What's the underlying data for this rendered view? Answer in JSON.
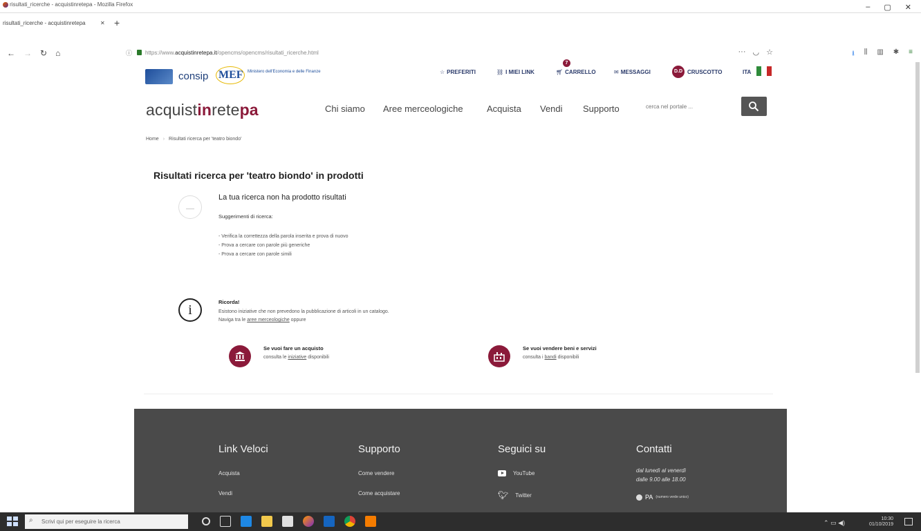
{
  "window": {
    "title": "risultati_ricerche - acquistinretepa - Mozilla Firefox",
    "controls": [
      "–",
      "▢",
      "✕"
    ]
  },
  "tab": {
    "label": "risultati_ricerche - acquistinretepa",
    "close": "✕",
    "new_tab": "+"
  },
  "urlbar": {
    "url_prefix": "https://www.",
    "url_domain": "acquistinretepa.it",
    "url_path": "/opencms/opencms/risultati_ricerche.html"
  },
  "header": {
    "consip": "consip",
    "mef": "MEF",
    "mef_sub": "Ministero dell'Economia e delle Finanze",
    "utility": {
      "preferiti": "PREFERITI",
      "miei_link": "I MIEI LINK",
      "carrello": "CARRELLO",
      "cart_count": "7",
      "messaggi": "MESSAGGI",
      "avatar": "D.D",
      "cruscotto": "CRUSCOTTO",
      "lang": "ITA"
    },
    "brand": {
      "part1": "acquist",
      "part2": "in",
      "part3": "rete",
      "part4": "pa"
    },
    "nav": [
      "Chi siamo",
      "Aree merceologiche",
      "Acquista",
      "Vendi",
      "Supporto"
    ],
    "search_placeholder": "cerca nel portale ..."
  },
  "breadcrumb": {
    "home": "Home",
    "current": "Risultati ricerca per 'teatro biondo'"
  },
  "results": {
    "title": "Risultati ricerca per 'teatro biondo' in prodotti",
    "no_result": "La tua ricerca non ha prodotto risultati",
    "suggestions_title": "Suggerimenti di ricerca:",
    "suggestions": [
      "- Verifica la correttezza della parola inserita e prova di nuovo",
      "- Prova a cercare con parole più generiche",
      "- Prova a cercare con parole simili"
    ]
  },
  "reminder": {
    "title": "Ricorda!",
    "line1": "Esistono iniziative che non prevedono la pubblicazione di articoli in un catalogo.",
    "line2_pre": "Naviga tra le ",
    "line2_link": "aree merceologiche",
    "line2_post": " oppure"
  },
  "cta": {
    "buy_title": "Se vuoi fare un acquisto",
    "buy_pre": "consulta le ",
    "buy_link": "iniziative",
    "buy_post": " disponibili",
    "sell_title": "Se vuoi vendere beni e servizi",
    "sell_pre": "consulta i ",
    "sell_link": "bandi",
    "sell_post": " disponibili"
  },
  "footer": {
    "link_veloci": {
      "title": "Link Veloci",
      "items": [
        "Acquista",
        "Vendi"
      ]
    },
    "supporto": {
      "title": "Supporto",
      "items": [
        "Come vendere",
        "Come acquistare"
      ]
    },
    "seguici": {
      "title": "Seguici su",
      "youtube": "YouTube",
      "twitter": "Twitter"
    },
    "contatti": {
      "title": "Contatti",
      "hours1": "dal lunedì al venerdì",
      "hours2": "dalle 9.00 alle 18.00",
      "pa": "PA",
      "pa_note": "(numero verde unico)"
    }
  },
  "taskbar": {
    "search_placeholder": "Scrivi qui per eseguire la ricerca",
    "time": "10:30",
    "date": "01/10/2019"
  },
  "colors": {
    "brand": "#8b1a3a",
    "footer": "#4a4a4a",
    "navy": "#2a3a6a"
  }
}
